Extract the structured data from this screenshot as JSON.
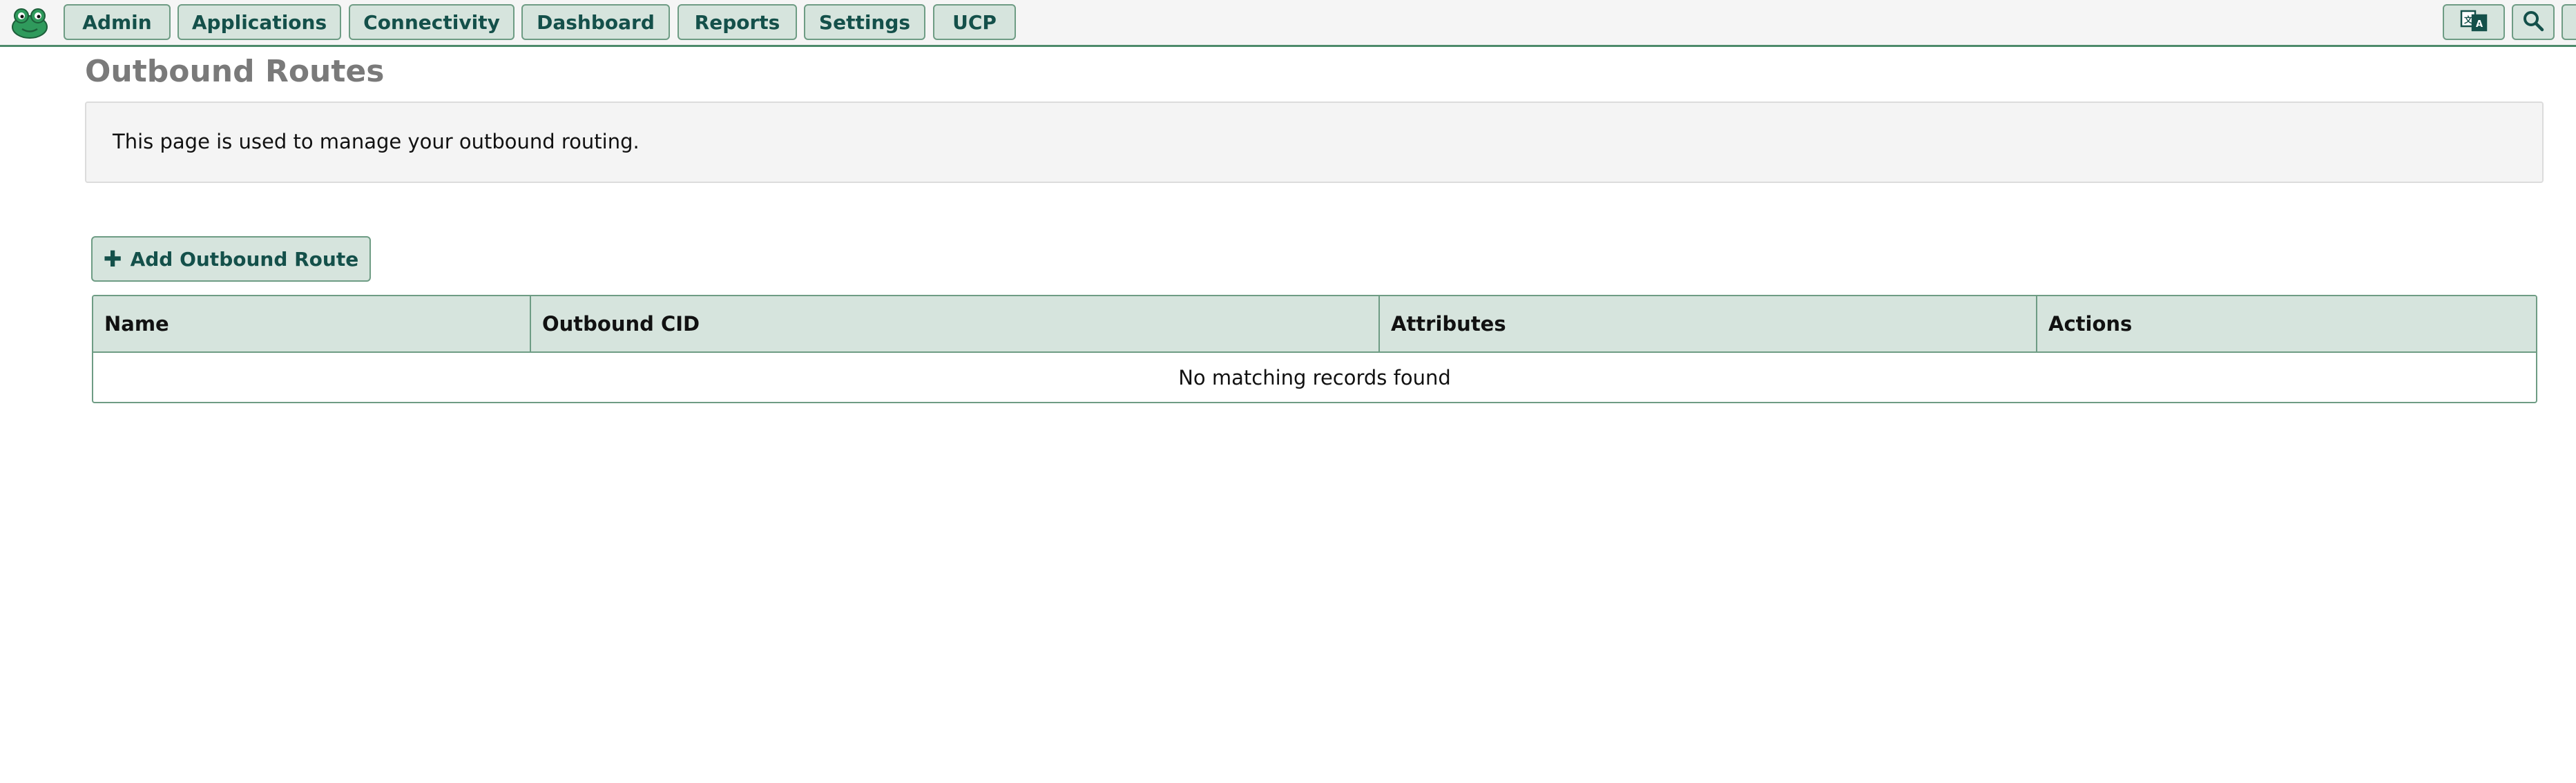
{
  "nav": {
    "items": [
      {
        "label": "Admin"
      },
      {
        "label": "Applications"
      },
      {
        "label": "Connectivity"
      },
      {
        "label": "Dashboard"
      },
      {
        "label": "Reports"
      },
      {
        "label": "Settings"
      },
      {
        "label": "UCP"
      }
    ],
    "icons": {
      "logo": "frog-logo-icon",
      "language": "language-icon",
      "search": "search-icon",
      "more": "more-icon"
    }
  },
  "page": {
    "title": "Outbound Routes",
    "description": "This page is used to manage your outbound routing."
  },
  "actions": {
    "add_label": "Add Outbound Route",
    "add_icon": "plus-icon"
  },
  "table": {
    "columns": [
      "Name",
      "Outbound CID",
      "Attributes",
      "Actions"
    ],
    "empty_message": "No matching records found"
  },
  "colors": {
    "accent": "#4c8a6a",
    "button_bg": "#d6e4dd",
    "button_text": "#14504a",
    "title_gray": "#7a7a7a"
  }
}
